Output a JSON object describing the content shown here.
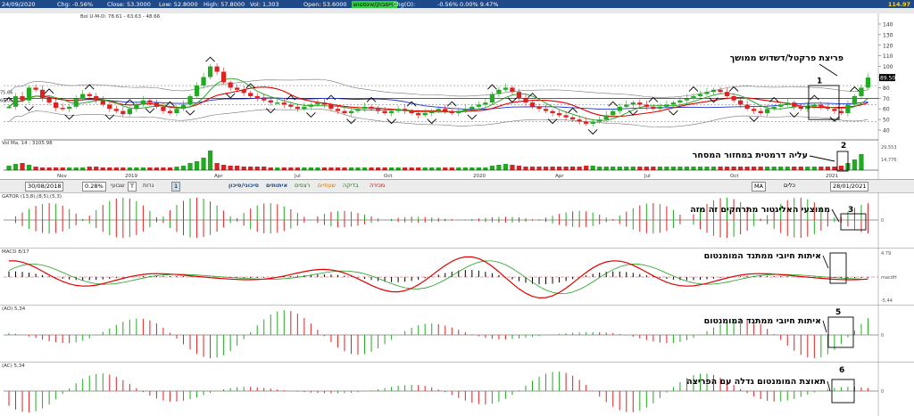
{
  "topbar": {
    "date": "24/09/2020",
    "chg": "Chg: -0.56%",
    "close": "Close: 53.3000",
    "low": "Low: 52.8000",
    "high": "High: 57.8000",
    "vol": "Vol: 1,303",
    "open": "Open: 53.6000",
    "highlight": "פייסבוק/אינסטוש",
    "chgo": "Chg(O):",
    "pct": "-0.56%  0.00%  9.47%",
    "last": "114.97"
  },
  "toolbar": {
    "start_date": "30/08/2018",
    "pct": "0.28%",
    "period_weekly": "שבועי",
    "period_candles": "נרות",
    "t_button": "T",
    "num": "1",
    "end_date": "28/01/2021",
    "btn_signals": "סיכוני/סיכון",
    "btn_identifications": "איתותים",
    "btn_colors": "רצפים",
    "btn_breakout": "שעתיים",
    "btn_test": "בדיקה",
    "btn_sale": "מכירה",
    "ma": "MA",
    "colors_label": "כלים"
  },
  "colors": {
    "up": "#22aa22",
    "down": "#dd2222",
    "ma_red": "#e00000",
    "ma_blue": "#2030d0",
    "ma_green": "#20a020",
    "annot_box": "#000000"
  },
  "chart_data": {
    "type": "candlestick",
    "main": {
      "info": "Bol U-M-D: 78.61 - 63.63 - 48.66",
      "y_ticks": [
        140,
        130,
        120,
        110,
        100,
        90,
        80,
        70,
        60,
        50,
        40
      ],
      "ylim": [
        35,
        145
      ],
      "last_label": "89.50",
      "left_labels": [
        "75.66",
        "68.06"
      ],
      "x_labels": [
        "Nov",
        "2019",
        "Apr",
        "Jul",
        "Oct",
        "2020",
        "Apr",
        "Jul",
        "Oct",
        "2021"
      ],
      "closes": [
        62,
        72,
        68,
        80,
        78,
        70,
        66,
        61,
        60,
        62,
        70,
        74,
        72,
        68,
        64,
        60,
        58,
        55,
        60,
        64,
        68,
        66,
        62,
        58,
        56,
        60,
        64,
        72,
        82,
        90,
        100,
        95,
        85,
        80,
        78,
        75,
        72,
        70,
        68,
        66,
        66,
        64,
        62,
        60,
        62,
        64,
        66,
        64,
        60,
        58,
        56,
        58,
        60,
        62,
        60,
        58,
        56,
        58,
        60,
        58,
        56,
        54,
        56,
        58,
        60,
        58,
        56,
        58,
        60,
        62,
        64,
        66,
        74,
        78,
        80,
        76,
        70,
        66,
        62,
        60,
        58,
        56,
        54,
        52,
        50,
        48,
        46,
        48,
        50,
        54,
        58,
        62,
        64,
        66,
        64,
        62,
        60,
        62,
        64,
        66,
        68,
        70,
        72,
        74,
        76,
        78,
        76,
        72,
        68,
        64,
        60,
        58,
        56,
        60,
        62,
        64,
        66,
        62,
        60,
        62,
        64,
        62,
        60,
        58,
        56,
        64,
        72,
        80,
        89.5
      ]
    },
    "volume": {
      "info": "Vol Ma, 14 : 3105.98",
      "right_labels": [
        "29,553",
        "14,776"
      ],
      "values": [
        5,
        7,
        8,
        6,
        4,
        3,
        3,
        3,
        3,
        3,
        3,
        3,
        4,
        4,
        3,
        3,
        3,
        3,
        3,
        3,
        3,
        3,
        3,
        3,
        3,
        4,
        5,
        8,
        10,
        14,
        22,
        8,
        6,
        5,
        5,
        4,
        4,
        4,
        4,
        3,
        3,
        3,
        3,
        3,
        3,
        3,
        3,
        3,
        3,
        3,
        3,
        3,
        3,
        3,
        3,
        3,
        3,
        3,
        3,
        3,
        3,
        3,
        3,
        3,
        3,
        3,
        3,
        3,
        3,
        3,
        3,
        3,
        5,
        6,
        7,
        6,
        5,
        4,
        4,
        4,
        4,
        4,
        4,
        4,
        4,
        4,
        5,
        5,
        4,
        4,
        4,
        4,
        4,
        4,
        4,
        4,
        4,
        4,
        4,
        4,
        4,
        4,
        4,
        4,
        4,
        4,
        4,
        4,
        4,
        4,
        4,
        4,
        4,
        4,
        4,
        4,
        4,
        4,
        4,
        4,
        4,
        4,
        4,
        4,
        5,
        8,
        12,
        18
      ]
    },
    "indicators": [
      {
        "name": "GATOR",
        "label": "GATOR (13,8),(8,5),(5,3)",
        "right_labels": [
          "0"
        ]
      },
      {
        "name": "MACD",
        "label": "MACD 8/17",
        "right_labels": [
          "4.79",
          "macdH",
          "-5.44"
        ]
      },
      {
        "name": "AO",
        "label": "(AO) 5,34",
        "right_labels": [
          "0"
        ]
      },
      {
        "name": "AC",
        "label": "(AC) 5,34",
        "right_labels": [
          "0"
        ]
      }
    ]
  },
  "annotations": [
    {
      "num": "1",
      "text": "פריצת פרקטל/דשדוש ממושך"
    },
    {
      "num": "2",
      "text": "עליה דרמטית במחזור המסחר"
    },
    {
      "num": "3",
      "text": "ממוצעי האליגטור מתרחקים זה מזה"
    },
    {
      "num": "4",
      "text": "איתות חיובי ממתנד המומנטום"
    },
    {
      "num": "5",
      "text": "איתות חיובי ממתנד המומנטום"
    },
    {
      "num": "6",
      "text": "תאוצת המומנטום גדלה עם הפריצה"
    }
  ]
}
